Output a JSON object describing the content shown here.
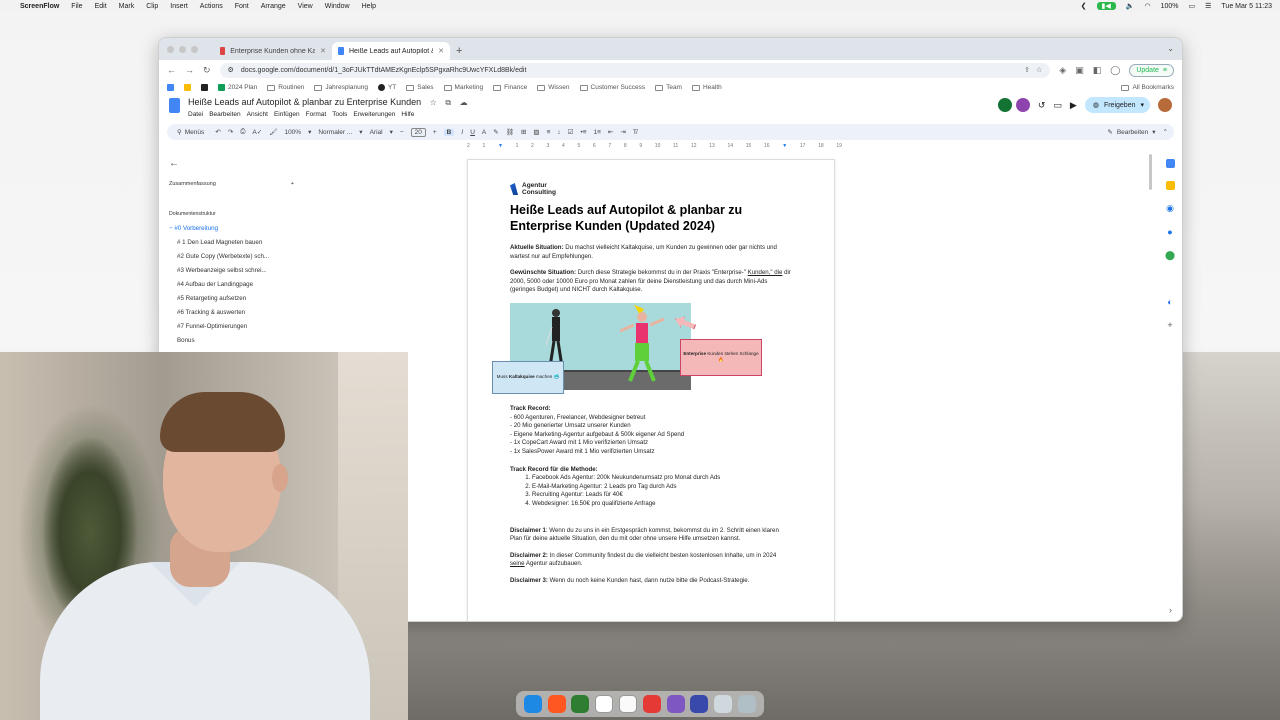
{
  "menubar": {
    "app": "ScreenFlow",
    "items": [
      "File",
      "Edit",
      "Mark",
      "Clip",
      "Insert",
      "Actions",
      "Font",
      "Arrange",
      "View",
      "Window",
      "Help"
    ],
    "battery": "100%",
    "clock": "Tue Mar 5  11:23"
  },
  "browser": {
    "tabs": [
      {
        "title": "Enterprise Kunden ohne Kaltakquise",
        "active": false
      },
      {
        "title": "Heiße Leads auf Autopilot & pla",
        "active": true
      }
    ],
    "url": "docs.google.com/document/d/1_3oFJUkTTdtAMEzKgnEclp5SPgxaRhc9UwcYFXLd8Bk/edit",
    "update_label": "Update",
    "bookmarks": [
      "2024 Plan",
      "Routinen",
      "Jahresplanung",
      "YT",
      "Sales",
      "Marketing",
      "Finance",
      "Wissen",
      "Customer Success",
      "Team",
      "Health"
    ],
    "all_bookmarks": "All Bookmarks"
  },
  "docs": {
    "title": "Heiße Leads auf Autopilot & planbar zu Enterprise Kunden",
    "menus": [
      "Datei",
      "Bearbeiten",
      "Ansicht",
      "Einfügen",
      "Format",
      "Tools",
      "Erweiterungen",
      "Hilfe"
    ],
    "share_label": "Freigeben",
    "toolbar": {
      "search": "Menüs",
      "zoom": "100%",
      "style": "Normaler ...",
      "font": "Arial",
      "font_size": "20",
      "mode": "Bearbeiten"
    },
    "ruler": [
      "2",
      "1",
      "1",
      "2",
      "3",
      "4",
      "5",
      "6",
      "7",
      "8",
      "9",
      "10",
      "11",
      "12",
      "13",
      "14",
      "15",
      "16",
      "17",
      "18",
      "19"
    ]
  },
  "outline": {
    "summary_label": "Zusammenfassung",
    "structure_label": "Dokumentenstruktur",
    "items": [
      "#0 Vorbereitung",
      "# 1 Den Lead Magneten bauen",
      "#2 Gute Copy (Werbetexte) sch...",
      "#3 Werbeanzeige selbst schrei...",
      "#4 Aufbau der Landingpage",
      "#5 Retargeting aufsetzen",
      "#6 Tracking & auswerten",
      "#7 Funnel-Optimierungen",
      "Bonus"
    ]
  },
  "page": {
    "logo_line1": "Agentur",
    "logo_line2": "Consulting",
    "heading": "Heiße Leads auf Autopilot & planbar zu Enterprise Kunden (Updated 2024)",
    "current_label": "Aktuelle Situation:",
    "current_text": " Du machst vielleicht Kaltakquise, um Kunden zu gewinnen oder gar nichts und wartest nur auf Empfehlungen.",
    "desired_label": "Gewünschte Situation:",
    "desired_text_1": " Durch diese Strategie bekommst du in der Praxis \"Enterprise-\" ",
    "desired_link": "Kunden,\" die",
    "desired_text_2": " dir 2000, 5000 oder 10000 Euro pro Monat zahlen für deine Dienstleistung und das durch Mini-Ads (geringes Budget) und NICHT durch Kaltakquise.",
    "callout_left_pre": "Muss ",
    "callout_left_bold": "Kaltakquise",
    "callout_left_post": " machen 🥶",
    "callout_right_bold": "Enterprise",
    "callout_right_rest": " Kunden stehen Schlange 🔥",
    "track_label": "Track Record:",
    "track_items": [
      "- 600 Agenturen, Freelancer, Webdesigner betreut",
      "- 20 Mio generierter Umsatz unserer Kunden",
      "- Eigene Marketing-Agentur aufgebaut & 500k eigener Ad Spend",
      "- 1x CopeCart Award mit 1 Mio verifizierten Umsatz",
      "- 1x SalesPower Award mit 1 Mio verifizierten Umsatz"
    ],
    "method_label": "Track Record für die Methode:",
    "method_items": [
      "Facebook Ads Agentur: 200k Neukundenumsatz pro Monat durch Ads",
      "E-Mail-Marketing Agentur: 2 Leads pro Tag durch Ads",
      "Recruiting Agentur: Leads für 40€",
      "Webdesigner: 16.50€ pro qualifizierte Anfrage"
    ],
    "d1_label": "Disclaimer 1",
    "d1_text": ": Wenn du zu uns in ein Erstgespräch kommst, bekommst du im 2. Schritt einen klaren Plan für deine aktuelle Situation, den du mit oder ohne unsere Hilfe umsetzen kannst.",
    "d2_label": "Disclaimer 2:",
    "d2_text_1": " In dieser Community findest du die vielleicht besten kostenlosen Inhalte, um in 2024 ",
    "d2_link": "seine",
    "d2_text_2": " Agentur aufzubauen.",
    "d3_label": "Disclaimer 3:",
    "d3_text": " Wenn du noch keine Kunden hast, dann nutze bitte die Podcast-Strategie."
  },
  "colors": {
    "docs_blue": "#1a73e8",
    "share_bg": "#c2e7ff",
    "toolbar_bg": "#edf2fa"
  }
}
